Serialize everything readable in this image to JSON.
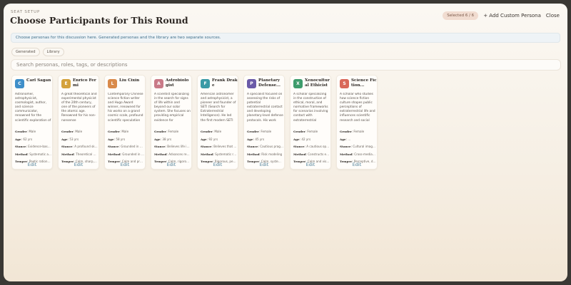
{
  "header": {
    "eyebrow": "SEAT SETUP",
    "title": "Choose Participants for This Round",
    "selected_badge": "Selected 6 / 6",
    "add_button": "+ Add Custom Persona",
    "close_button": "Close"
  },
  "info": "Choose personas for this discussion here. Generated personas and the library are two separate sources.",
  "tabs": [
    "Generated",
    "Library"
  ],
  "search": {
    "placeholder": "Search personas, roles, tags, or descriptions"
  },
  "labels": {
    "gender": "Gender",
    "age": "Age",
    "stance": "Stance",
    "method": "Method",
    "temper": "Temper",
    "edit": "Edit"
  },
  "personas": [
    {
      "initial": "C",
      "color": "#3f8fc9",
      "name": "Carl Sagan",
      "description": "Astronomer, astrophysicist, cosmologist, author, and science communicator, renowned for the scientific exploration of",
      "gender": "Male",
      "age": "62 yrs",
      "stance": "Evidence-based optimism",
      "method": "Systematic and empirical",
      "temper": "Poetic rationalist"
    },
    {
      "initial": "E",
      "color": "#d4a23c",
      "name": "Enrico Fermi",
      "description": "A great theoretical and experimental physicist of the 20th century, one of the pioneers of the atomic age. Renowned for his non-nonsense",
      "gender": "Male",
      "age": "53 yrs",
      "stance": "A profound skeptic",
      "method": "Theoretical physics",
      "temper": "Calm, sharp, frank"
    },
    {
      "initial": "L",
      "color": "#d98a4a",
      "name": "Liu Cixin",
      "description": "Contemporary Chinese science fiction writer and Hugo Award winner, renowned for his works on a grand cosmic scale, profound scientific speculation",
      "gender": "Male",
      "age": "58 yrs",
      "stance": "Grounded in dark forest",
      "method": "Grounded in hard science",
      "temper": "Calm and profound"
    },
    {
      "initial": "A",
      "color": "#c97a88",
      "name": "Astrobiologist",
      "description": "A scientist specializing in the search for signs of life within and beyond our solar system. She focuses on providing empirical evidence for",
      "gender": "Female",
      "age": "38 yrs",
      "stance": "Believes life is common",
      "method": "Advances research",
      "temper": "Calm, rigorous, open"
    },
    {
      "initial": "F",
      "color": "#3a9aa6",
      "name": "Frank Drake",
      "description": "American astronomer and astrophysicist, a pioneer and founder of SETI (Search for Extraterrestrial Intelligence). He led the first modern SETI",
      "gender": "Male",
      "age": "92 yrs",
      "stance": "Believes that advanced",
      "method": "Systematic radio search",
      "temper": "Rigorous, persistent"
    },
    {
      "initial": "P",
      "color": "#6a5aa8",
      "name": "Planetary Defense...",
      "description": "A specialist focused on assessing the risks of potential extraterrestrial contact and developing planetary-level defense protocols. His work",
      "gender": "Female",
      "age": "45 yrs",
      "stance": "Cautious pragmatism",
      "method": "Risk modeling",
      "temper": "Calm, systematic"
    },
    {
      "initial": "X",
      "color": "#3e9c6c",
      "name": "Xenocultural Ethicist",
      "description": "A scholar specializing in the construction of ethical, moral, and normative frameworks for scenarios involving contact with extraterrestrial",
      "gender": "Female",
      "age": "42 yrs",
      "stance": "A cautious optimist",
      "method": "Constructs ethical",
      "temper": "Calm and visionary"
    },
    {
      "initial": "S",
      "color": "#d9685a",
      "name": "Science Fiction...",
      "description": "A scholar who studies how science fiction culture shapes public perceptions of extraterrestrial life and influences scientific research and social",
      "gender": "Female",
      "age": "...",
      "stance": "Cultural imagination",
      "method": "Cross-media analysis",
      "temper": "Perceptive, direct"
    }
  ]
}
